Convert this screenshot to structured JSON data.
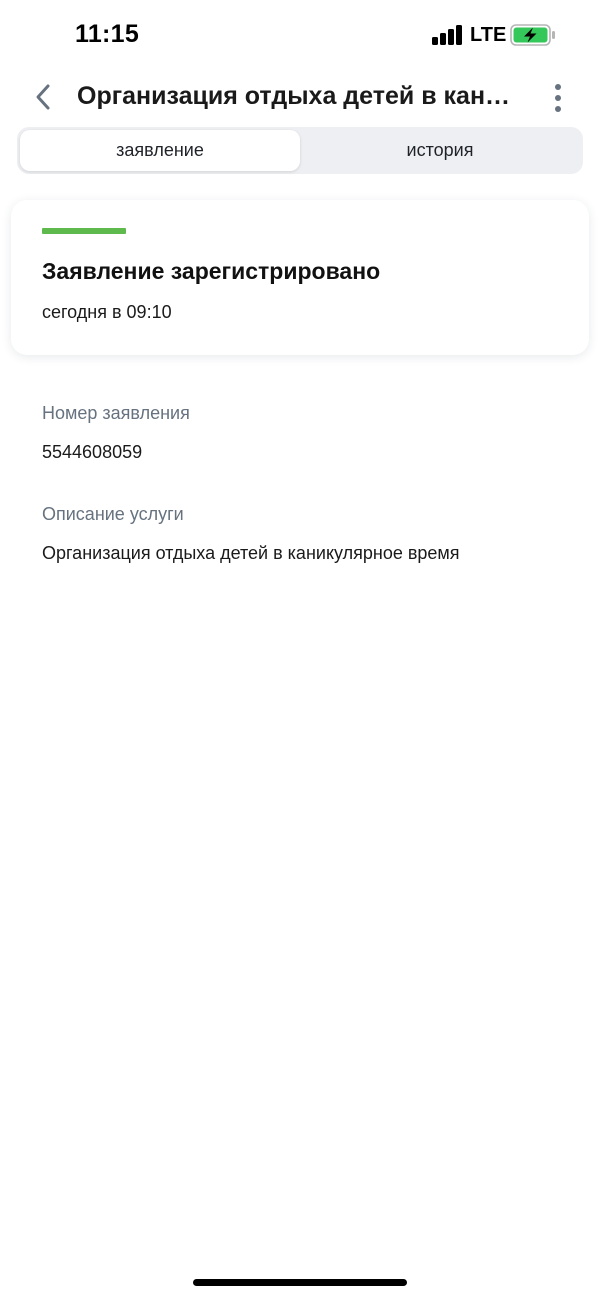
{
  "status_bar": {
    "time": "11:15",
    "network": "LTE",
    "battery_color": "#34c759",
    "signal_icon": "cellular-signal-icon",
    "battery_icon": "battery-charging-icon"
  },
  "header": {
    "title": "Организация отдыха детей в каникулярное время",
    "back_icon": "chevron-left-icon",
    "more_icon": "more-vertical-icon"
  },
  "tabs": [
    {
      "label": "заявление",
      "active": true
    },
    {
      "label": "история",
      "active": false
    }
  ],
  "status_card": {
    "title": "Заявление зарегистрировано",
    "date": "сегодня в 09:10",
    "accent_color": "#5fba4e"
  },
  "details": {
    "application_number": {
      "label": "Номер заявления",
      "value": "5544608059"
    },
    "service_description": {
      "label": "Описание услуги",
      "value": "Организация отдыха детей в каникулярное время"
    }
  },
  "colors": {
    "label_gray": "#66727f",
    "tabs_bg": "#eeeff2"
  }
}
